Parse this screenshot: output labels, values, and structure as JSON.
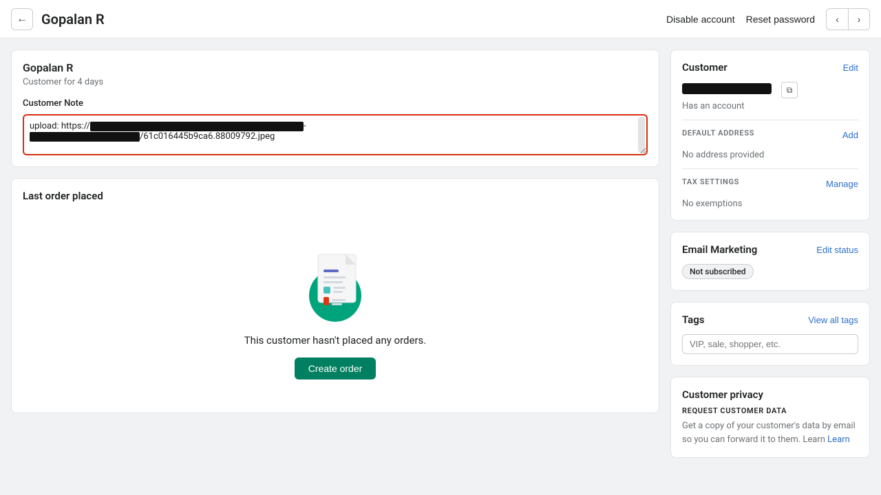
{
  "header": {
    "back_label": "←",
    "title": "Gopalan R",
    "disable_account": "Disable account",
    "reset_password": "Reset password",
    "prev_arrow": "‹",
    "next_arrow": "›"
  },
  "customer_card": {
    "name": "Gopalan R",
    "since": "Customer for 4 days",
    "note_label": "Customer Note",
    "note_prefix": "upload: https://",
    "note_suffix": "/61c016445b9ca6.88009792.jpeg"
  },
  "last_order": {
    "title": "Last order placed",
    "empty_text": "This customer hasn't placed any orders.",
    "create_order_label": "Create order"
  },
  "right_panel": {
    "customer_section": {
      "title": "Customer",
      "edit_label": "Edit",
      "has_account": "Has an account",
      "copy_tooltip": "Copy"
    },
    "default_address": {
      "label": "DEFAULT ADDRESS",
      "add_label": "Add",
      "no_address": "No address provided"
    },
    "tax_settings": {
      "label": "TAX SETTINGS",
      "manage_label": "Manage",
      "no_exemptions": "No exemptions"
    },
    "email_marketing": {
      "title": "Email Marketing",
      "edit_status_label": "Edit status",
      "badge": "Not subscribed"
    },
    "tags": {
      "title": "Tags",
      "view_all_label": "View all tags",
      "placeholder": "VIP, sale, shopper, etc."
    },
    "customer_privacy": {
      "title": "Customer privacy",
      "request_label": "REQUEST CUSTOMER DATA",
      "request_text": "Get a copy of your customer's data by email so you can forward it to them. Learn"
    }
  }
}
